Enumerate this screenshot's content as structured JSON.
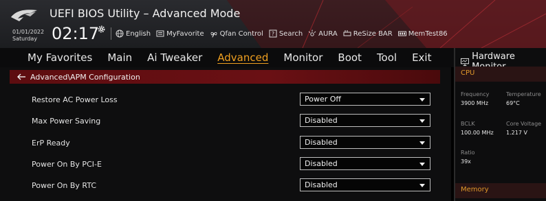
{
  "header": {
    "title": "UEFI BIOS Utility – Advanced Mode",
    "date": "01/01/2022",
    "day": "Saturday",
    "time": "02:17",
    "tools": [
      {
        "label": "English",
        "icon": "globe-icon"
      },
      {
        "label": "MyFavorite",
        "icon": "favorite-list-icon"
      },
      {
        "label": "Qfan Control",
        "icon": "fan-icon"
      },
      {
        "label": "Search",
        "icon": "search-help-icon"
      },
      {
        "label": "AURA",
        "icon": "aura-icon"
      },
      {
        "label": "ReSize BAR",
        "icon": "resize-bar-icon"
      },
      {
        "label": "MemTest86",
        "icon": "memtest-icon"
      }
    ]
  },
  "nav": {
    "items": [
      "My Favorites",
      "Main",
      "Ai Tweaker",
      "Advanced",
      "Monitor",
      "Boot",
      "Tool",
      "Exit"
    ],
    "active": "Advanced"
  },
  "main": {
    "breadcrumb": "Advanced\\APM Configuration",
    "settings": [
      {
        "label": "Restore AC Power Loss",
        "value": "Power Off"
      },
      {
        "label": "Max Power Saving",
        "value": "Disabled"
      },
      {
        "label": "ErP Ready",
        "value": "Disabled"
      },
      {
        "label": "Power On By PCI-E",
        "value": "Disabled"
      },
      {
        "label": "Power On By RTC",
        "value": "Disabled"
      }
    ]
  },
  "hardware_monitor": {
    "title": "Hardware Monitor",
    "cpu_label": "CPU",
    "frequency_label": "Frequency",
    "frequency_value": "3900 MHz",
    "temperature_label": "Temperature",
    "temperature_value": "69°C",
    "bclk_label": "BCLK",
    "bclk_value": "100.00 MHz",
    "core_voltage_label": "Core Voltage",
    "core_voltage_value": "1.217 V",
    "ratio_label": "Ratio",
    "ratio_value": "39x",
    "memory_label": "Memory"
  },
  "colors": {
    "accent": "#f0a020",
    "breadcrumb_bg": "#6a1014",
    "section_label": "#e0982a"
  }
}
